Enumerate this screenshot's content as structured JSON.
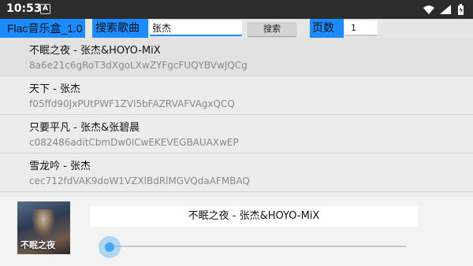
{
  "status_bar": {
    "time": "10:53",
    "left_icon": "A",
    "right_icons": [
      "wifi-icon",
      "cellular-icon",
      "battery-icon"
    ]
  },
  "toolbar": {
    "app_title": "Flac音乐盒_1.0",
    "search_label": "搜索歌曲",
    "search_value": "张杰",
    "search_button": "搜索",
    "page_label": "页数",
    "page_value": "1"
  },
  "songs": [
    {
      "title": "不眠之夜 - 张杰&HOYO-MiX",
      "id": "8a6e21c6gRoT3dXgoLXwZYFgcFUQYBVwJQCg"
    },
    {
      "title": "天下 - 张杰",
      "id": "f05ffd90JxPUtPWF1ZVl5bFAZRVAFVAgxQCQ"
    },
    {
      "title": "只要平凡 - 张杰&张碧晨",
      "id": "c082486aditCbmDw0lCwEKEVEGBAUAXwEP"
    },
    {
      "title": "雪龙吟 - 张杰",
      "id": "cec712fdVAK9doW1VZXlBdRlMGVQdaAFMBAQ"
    }
  ],
  "player": {
    "album_text": "不眠之夜",
    "now_playing": "不眠之夜 - 张杰&HOYO-MiX",
    "progress_fraction": 0.01
  },
  "colors": {
    "accent": "#1a8cff",
    "seek": "#3fa9f5",
    "status_bar": "#2c2c2c"
  }
}
